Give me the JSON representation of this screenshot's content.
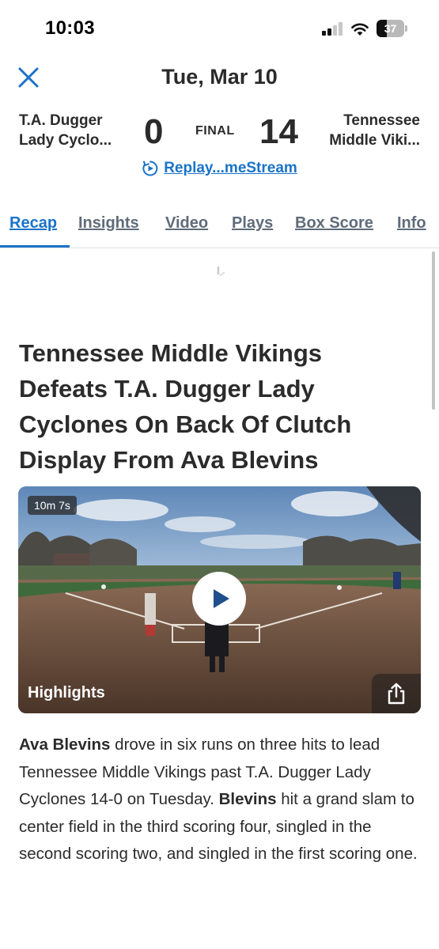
{
  "status_bar": {
    "time": "10:03",
    "battery_level": "37",
    "signal_bars_on": 2,
    "signal_bars_total": 4
  },
  "header": {
    "title": "Tue, Mar 10",
    "close_icon": "close-icon"
  },
  "game": {
    "away_team_line1": "T.A. Dugger",
    "away_team_line2": "Lady Cyclo...",
    "away_score": "0",
    "status": "FINAL",
    "home_score": "14",
    "home_team_line1": "Tennessee",
    "home_team_line2": "Middle Viki..."
  },
  "replay": {
    "icon": "replay-icon",
    "label": "Replay...meStream"
  },
  "tabs": [
    {
      "label": "Recap",
      "active": true
    },
    {
      "label": "Insights",
      "active": false
    },
    {
      "label": "Video",
      "active": false
    },
    {
      "label": "Plays",
      "active": false
    },
    {
      "label": "Box Score",
      "active": false
    },
    {
      "label": "Info",
      "active": false
    }
  ],
  "article": {
    "title": "Tennessee Middle Vikings Defeats T.A. Dugger Lady Cyclones On Back Of Clutch Display From Ava Blevins",
    "video": {
      "duration": "10m 7s",
      "label": "Highlights",
      "play_icon": "play-icon",
      "share_icon": "share-icon"
    },
    "body": {
      "p1_bold": "Ava Blevins",
      "p1_rest": " drove in six runs on three hits to lead Tennessee Middle Vikings past T.A. Dugger Lady Cyclones 14-0 on Tuesday. ",
      "p2_bold": "Blevins",
      "p2_rest": " hit a grand slam to center field in the third scoring four, singled in the second scoring two, and singled in the first scoring one."
    }
  },
  "colors": {
    "accent": "#1a73c8",
    "text": "#2b2b2b",
    "tab_inactive": "#5f6b7a"
  }
}
